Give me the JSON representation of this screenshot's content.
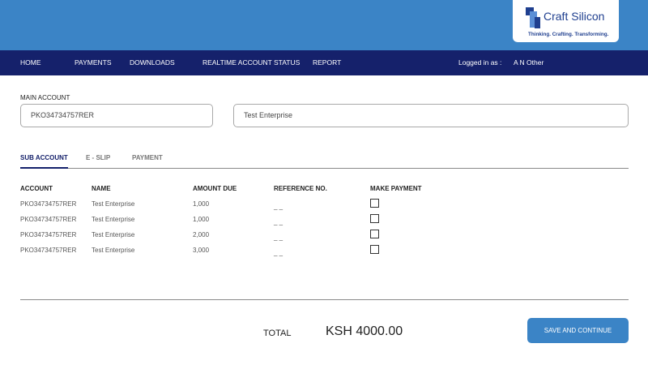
{
  "brand": {
    "name": "Craft Silicon",
    "tagline": "Thinking. Crafting. Transforming.",
    "colors": {
      "primary": "#3b84c6",
      "navy": "#15216b",
      "logo": "#1f3f8f"
    }
  },
  "nav": {
    "items": [
      "HOME",
      "PAYMENTS",
      "DOWNLOADS",
      "REALTIME ACCOUNT STATUS",
      "REPORT"
    ],
    "logged_in_label": "Logged in as :",
    "user_name": "A N Other"
  },
  "main_account": {
    "label": "MAIN ACCOUNT",
    "account_value": "PKO34734757RER",
    "name_value": "Test Enterprise"
  },
  "tabs": [
    {
      "label": "SUB ACCOUNT",
      "active": true
    },
    {
      "label": "E - SLIP",
      "active": false
    },
    {
      "label": "PAYMENT",
      "active": false
    }
  ],
  "table": {
    "headers": [
      "ACCOUNT",
      "NAME",
      "AMOUNT DUE",
      "REFERENCE NO.",
      "MAKE PAYMENT"
    ],
    "rows": [
      {
        "account": "PKO34734757RER",
        "name": "Test Enterprise",
        "amount": "1,000",
        "reference": "_ _",
        "checked": false
      },
      {
        "account": "PKO34734757RER",
        "name": "Test Enterprise",
        "amount": "1,000",
        "reference": "_ _",
        "checked": false
      },
      {
        "account": "PKO34734757RER",
        "name": "Test Enterprise",
        "amount": "2,000",
        "reference": "_ _",
        "checked": false
      },
      {
        "account": "PKO34734757RER",
        "name": "Test Enterprise",
        "amount": "3,000",
        "reference": "_ _",
        "checked": false
      }
    ]
  },
  "footer": {
    "total_label": "TOTAL",
    "total_value": "KSH 4000.00",
    "save_label": "SAVE AND CONTINUE"
  }
}
